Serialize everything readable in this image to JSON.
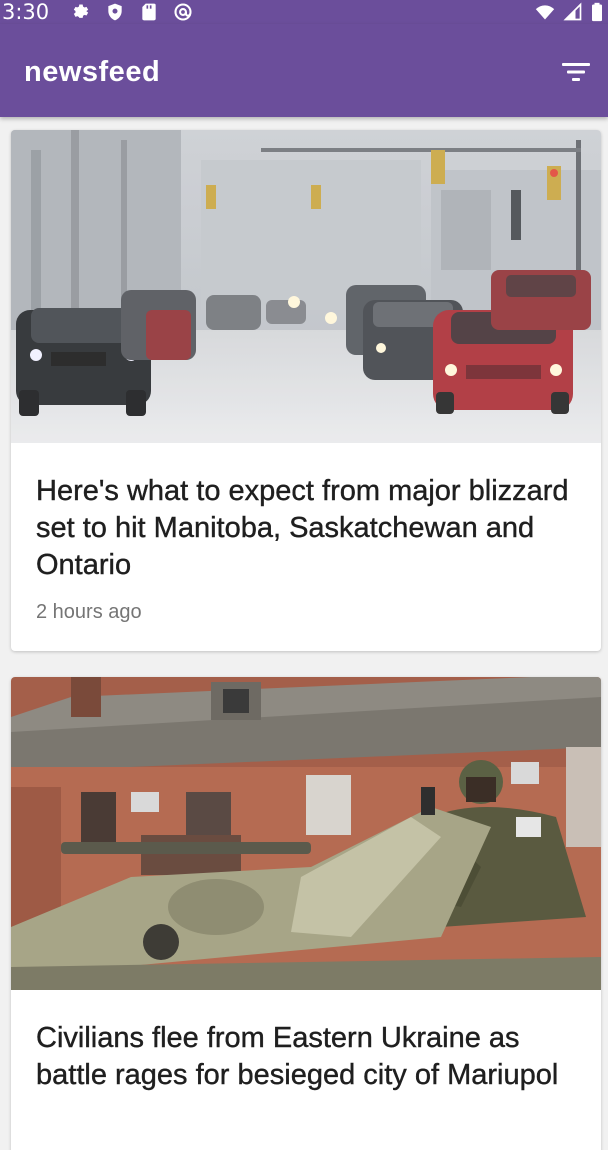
{
  "status_bar": {
    "time": "3:30",
    "left_icons": [
      "settings-gear-icon",
      "shield-icon",
      "sd-card-icon",
      "at-sign-icon"
    ],
    "right_icons": [
      "wifi-icon",
      "cellular-signal-icon",
      "battery-icon"
    ]
  },
  "app_bar": {
    "title": "newsfeed",
    "action_icon": "filter-icon",
    "background": "#6b4e9b"
  },
  "articles": [
    {
      "title": "Here's what to expect from major blizzard set to hit Manitoba, Saskatchewan and Ontario",
      "time": "2 hours ago",
      "image": "snowy-street-traffic"
    },
    {
      "title": "Civilians flee from Eastern Ukraine as battle rages for besieged city of Mariupol",
      "time": "",
      "image": "soldier-on-armored-vehicle"
    }
  ]
}
